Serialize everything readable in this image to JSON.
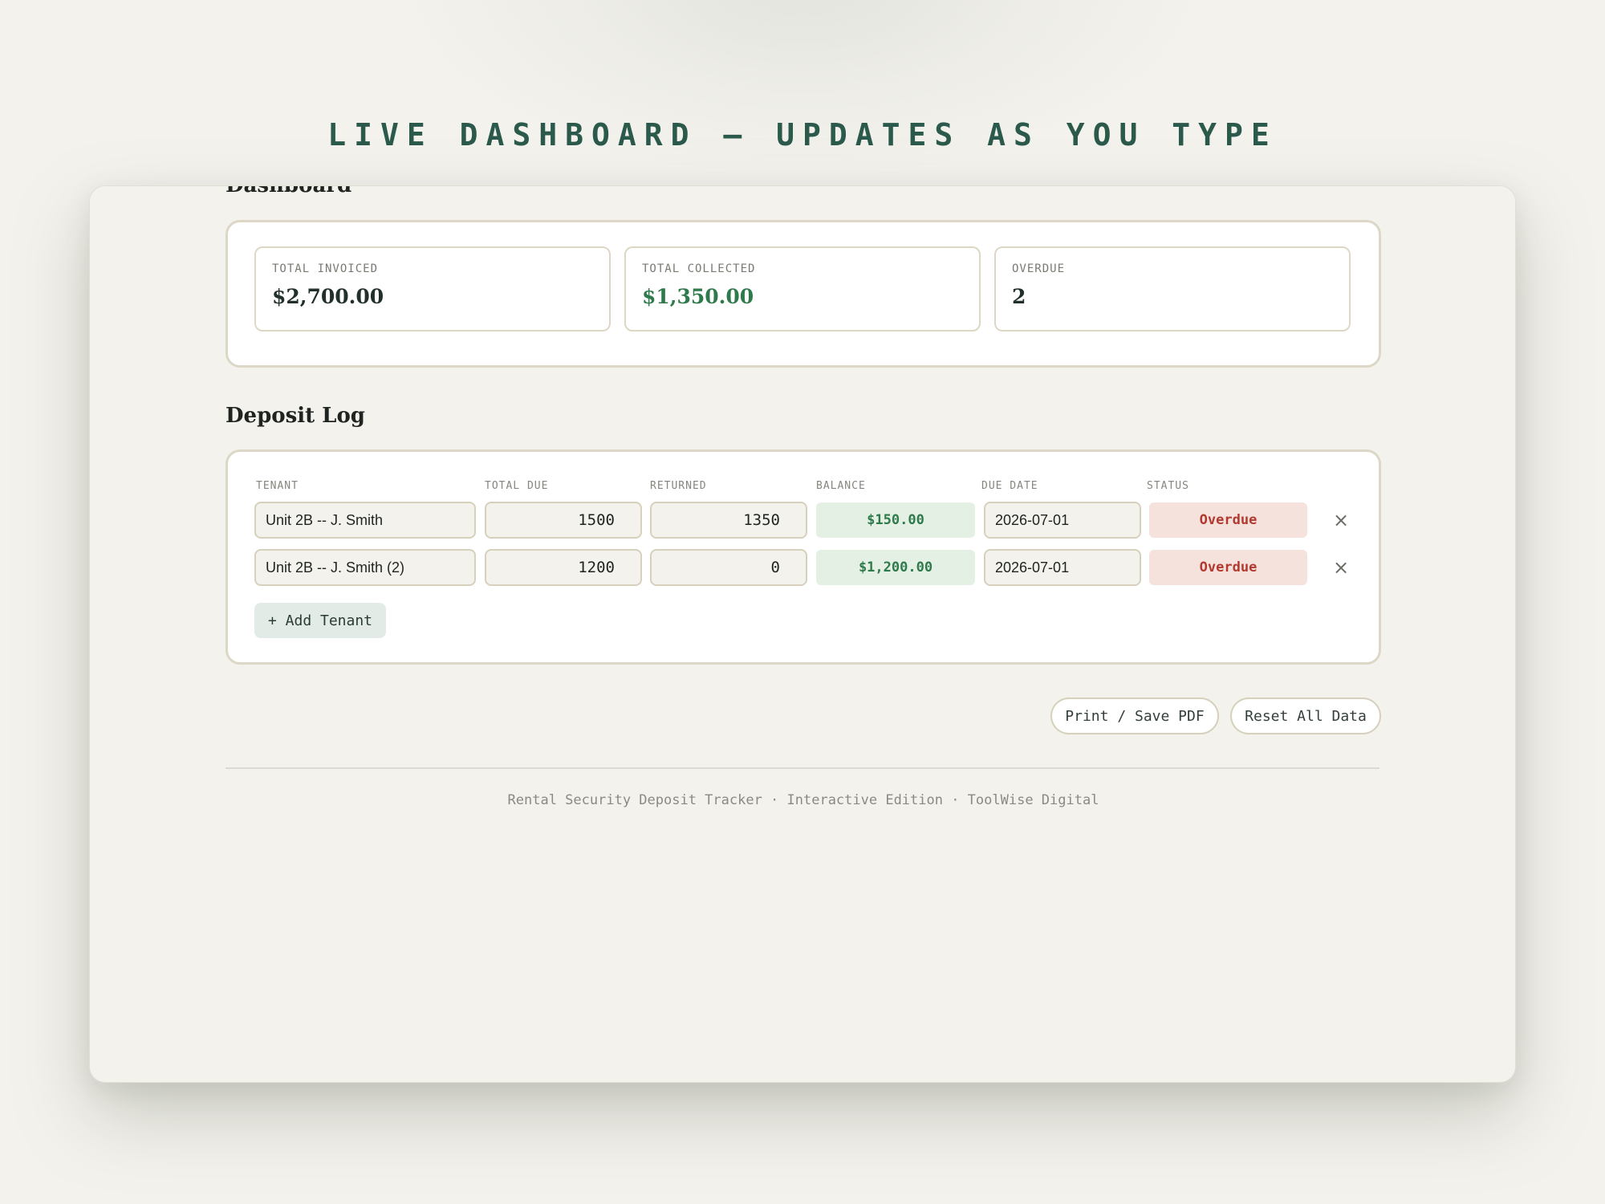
{
  "headline": "LIVE DASHBOARD — UPDATES AS YOU TYPE",
  "dashboard": {
    "title": "Dashboard",
    "stats": [
      {
        "label": "TOTAL INVOICED",
        "value": "$2,700.00",
        "color": "#22302a"
      },
      {
        "label": "TOTAL COLLECTED",
        "value": "$1,350.00",
        "color": "#2e7a4a"
      },
      {
        "label": "OVERDUE",
        "value": "2",
        "color": "#22302a"
      }
    ]
  },
  "deposit_log": {
    "title": "Deposit Log",
    "columns": [
      "TENANT",
      "TOTAL DUE",
      "RETURNED",
      "BALANCE",
      "DUE DATE",
      "STATUS"
    ],
    "rows": [
      {
        "tenant": "Unit 2B -- J. Smith",
        "total_due": "1500",
        "returned": "1350",
        "balance": "$150.00",
        "due_date": "2026-07-01",
        "status": "Overdue"
      },
      {
        "tenant": "Unit 2B -- J. Smith (2)",
        "total_due": "1200",
        "returned": "0",
        "balance": "$1,200.00",
        "due_date": "2026-07-01",
        "status": "Overdue"
      }
    ],
    "remove_icon": "×",
    "add_label": "+ Add Tenant"
  },
  "actions": {
    "print_label": "Print / Save PDF",
    "reset_label": "Reset All Data"
  },
  "footer": "Rental Security Deposit Tracker · Interactive Edition · ToolWise Digital",
  "colors": {
    "accent": "#2b5a4c",
    "positive": "#2e7a4a",
    "overdue": "#b3392f"
  }
}
